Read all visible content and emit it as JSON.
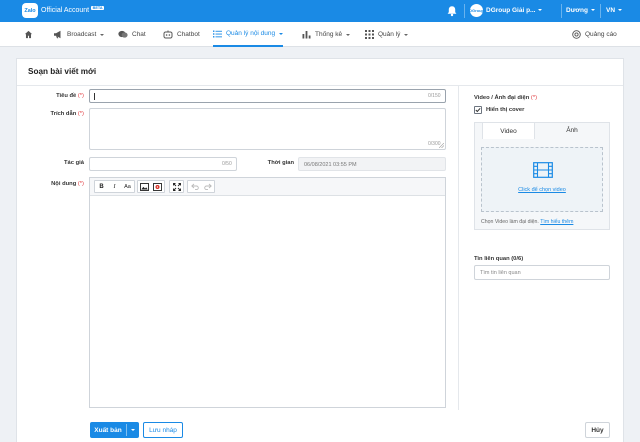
{
  "header": {
    "brand_badge": "Zalo",
    "brand_name": "Official Account",
    "beta_badge": "BETA",
    "account_avatar": "DGroup",
    "account_name": "DGroup Giải p...",
    "user_name": "Dương",
    "language": "VN",
    "icons": [
      "logo",
      "bell-icon",
      "chevron-down-icon"
    ],
    "color": "#1a8ae5"
  },
  "nav": {
    "items": [
      {
        "label": "",
        "icon": "home-icon"
      },
      {
        "label": "Broadcast",
        "icon": "broadcast-icon"
      },
      {
        "label": "Chat",
        "icon": "chat-icon"
      },
      {
        "label": "Chatbot",
        "icon": "chatbot-icon"
      },
      {
        "label": "Quản lý nội dung",
        "icon": "list-icon",
        "active": true
      },
      {
        "label": "Thống kê",
        "icon": "bar-chart-icon"
      },
      {
        "label": "Quản lý",
        "icon": "grid-icon"
      }
    ],
    "ads_label": "Quảng cáo"
  },
  "form": {
    "title": "Soạn bài viết mới",
    "title_label": "Tiêu đề",
    "title_value": "",
    "title_counter": "0/150",
    "excerpt_label": "Trích dẫn",
    "excerpt_counter": "0/300",
    "author_label": "Tác giả",
    "author_counter": "0/50",
    "time_label": "Thời gian",
    "time_value": "06/08/2021 03:55 PM",
    "content_label": "Nội dung",
    "required_mark": "(*)",
    "toolbar": {
      "bold": "B",
      "italic": "I",
      "font_size": "Aa",
      "icons": [
        "image-icon",
        "video-icon",
        "fullscreen-icon",
        "undo-icon",
        "redo-icon"
      ]
    }
  },
  "sidebar": {
    "media_label": "Video / Ảnh đại diện",
    "cover_checkbox_label": "Hiển thị cover",
    "cover_checked": true,
    "tabs": [
      "Video",
      "Ảnh"
    ],
    "active_tab": "Video",
    "upload_link": "Click để chọn video",
    "hint": "Chọn Video làm đại diện.",
    "hint_link": "Tìm hiểu thêm",
    "related_label": "Tin liên quan (0/6)",
    "related_placeholder": "Tìm tin liên quan"
  },
  "actions": {
    "publish": "Xuất bản",
    "draft": "Lưu nháp",
    "cancel": "Hủy"
  }
}
